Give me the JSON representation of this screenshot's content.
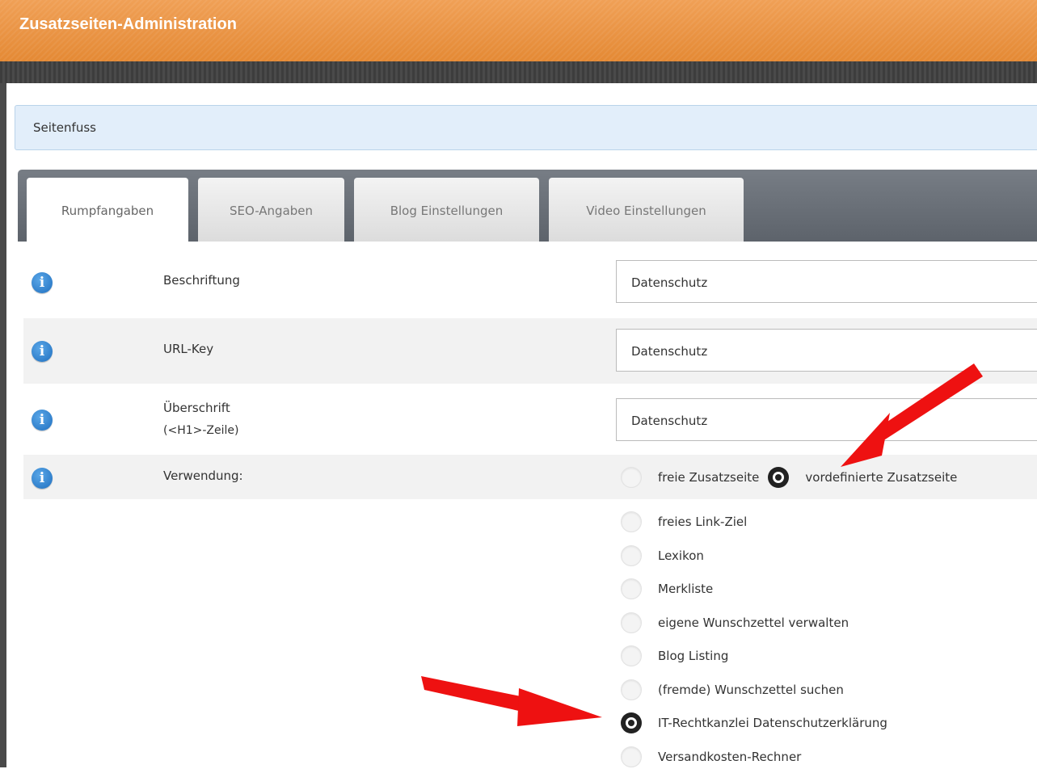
{
  "window": {
    "title": "Zusatzseiten-Administration"
  },
  "section": {
    "title": "Seitenfuss"
  },
  "tabs": [
    {
      "label": "Rumpfangaben",
      "active": true
    },
    {
      "label": "SEO-Angaben",
      "active": false
    },
    {
      "label": "Blog Einstellungen",
      "active": false
    },
    {
      "label": "Video Einstellungen",
      "active": false
    }
  ],
  "form": {
    "beschriftung": {
      "label": "Beschriftung",
      "value": "Datenschutz"
    },
    "url_key": {
      "label": "URL-Key",
      "value": "Datenschutz"
    },
    "ueberschrift": {
      "label_line1": "Überschrift",
      "label_line2": "(<H1>-Zeile)",
      "value": "Datenschutz"
    },
    "verwendung": {
      "label": "Verwendung:",
      "options": [
        {
          "label": "freie Zusatzseite",
          "checked": false
        },
        {
          "label": "vordefinierte Zusatzseite",
          "checked": true
        }
      ]
    },
    "predefined_pages": [
      {
        "label": "freies Link-Ziel",
        "checked": false
      },
      {
        "label": "Lexikon",
        "checked": false
      },
      {
        "label": "Merkliste",
        "checked": false
      },
      {
        "label": "eigene Wunschzettel verwalten",
        "checked": false
      },
      {
        "label": "Blog Listing",
        "checked": false
      },
      {
        "label": "(fremde) Wunschzettel suchen",
        "checked": false
      },
      {
        "label": "IT-Rechtkanzlei Datenschutzerklärung",
        "checked": true
      },
      {
        "label": "Versandkosten-Rechner",
        "checked": false
      }
    ]
  },
  "icons": {
    "info": "info-icon",
    "arrow": "red-arrow-annotation"
  },
  "colors": {
    "header_orange": "#e8913c",
    "info_blue": "#2b7fd0",
    "arrow_red": "#ee1111",
    "section_blue": "#e2eefa"
  }
}
